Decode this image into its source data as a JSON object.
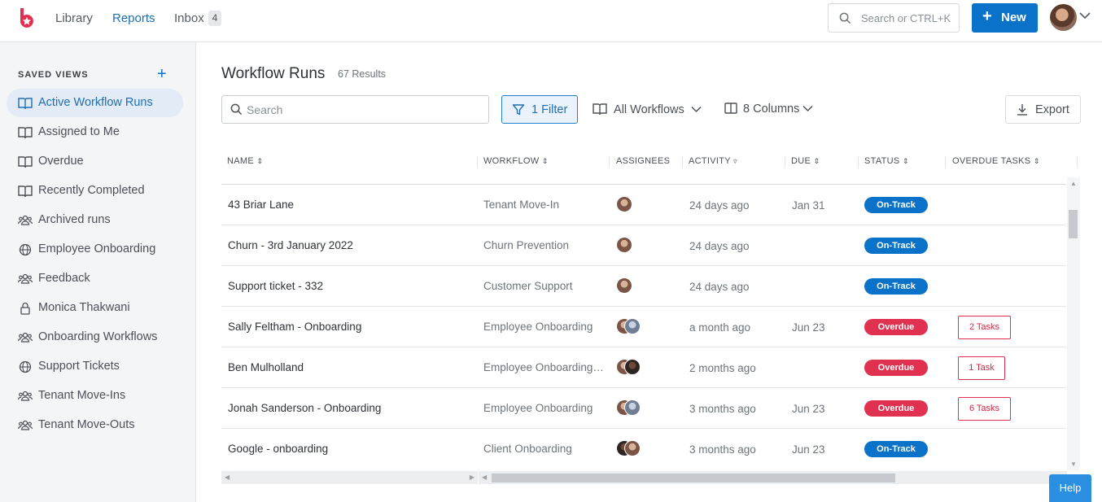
{
  "nav": {
    "library": "Library",
    "reports": "Reports",
    "inbox": "Inbox",
    "inbox_count": "4"
  },
  "header": {
    "search_placeholder": "Search or CTRL+K",
    "new_button": "New"
  },
  "sidebar": {
    "title": "SAVED VIEWS",
    "items": [
      {
        "label": "Active Workflow Runs",
        "icon": "book-icon",
        "active": true
      },
      {
        "label": "Assigned to Me",
        "icon": "book-icon"
      },
      {
        "label": "Overdue",
        "icon": "book-icon"
      },
      {
        "label": "Recently Completed",
        "icon": "book-icon"
      },
      {
        "label": "Archived runs",
        "icon": "users-icon"
      },
      {
        "label": "Employee Onboarding",
        "icon": "globe-icon"
      },
      {
        "label": "Feedback",
        "icon": "users-icon"
      },
      {
        "label": "Monica Thakwani",
        "icon": "lock-icon"
      },
      {
        "label": "Onboarding Workflows",
        "icon": "users-icon"
      },
      {
        "label": "Support Tickets",
        "icon": "globe-icon"
      },
      {
        "label": "Tenant Move-Ins",
        "icon": "users-icon"
      },
      {
        "label": "Tenant Move-Outs",
        "icon": "users-icon"
      }
    ]
  },
  "main": {
    "title": "Workflow Runs",
    "results": "67 Results",
    "search_placeholder": "Search",
    "filter_label": "1 Filter",
    "workflows_label": "All Workflows",
    "columns_label": "8 Columns",
    "export_label": "Export",
    "help_label": "Help"
  },
  "table": {
    "columns": [
      "NAME",
      "WORKFLOW",
      "ASSIGNEES",
      "ACTIVITY",
      "DUE",
      "STATUS",
      "OVERDUE TASKS"
    ],
    "rows": [
      {
        "name": "43 Briar Lane",
        "workflow": "Tenant Move-In",
        "activity": "24 days ago",
        "due": "Jan 31",
        "status": "On-Track",
        "tasks": ""
      },
      {
        "name": "Churn - 3rd January 2022",
        "workflow": "Churn Prevention",
        "activity": "24 days ago",
        "due": "",
        "status": "On-Track",
        "tasks": ""
      },
      {
        "name": "Support ticket - 332",
        "workflow": "Customer Support",
        "activity": "24 days ago",
        "due": "",
        "status": "On-Track",
        "tasks": ""
      },
      {
        "name": "Sally Feltham - Onboarding",
        "workflow": "Employee Onboarding",
        "activity": "a month ago",
        "due": "Jun 23",
        "status": "Overdue",
        "tasks": "2 Tasks"
      },
      {
        "name": "Ben Mulholland",
        "workflow": "Employee Onboarding ...",
        "activity": "2 months ago",
        "due": "",
        "status": "Overdue",
        "tasks": "1 Task"
      },
      {
        "name": "Jonah Sanderson - Onboarding",
        "workflow": "Employee Onboarding",
        "activity": "3 months ago",
        "due": "Jun 23",
        "status": "Overdue",
        "tasks": "6 Tasks"
      },
      {
        "name": "Google - onboarding",
        "workflow": "Client Onboarding",
        "activity": "3 months ago",
        "due": "Jun 23",
        "status": "On-Track",
        "tasks": ""
      }
    ]
  },
  "colors": {
    "primary": "#0b72c9",
    "overdue": "#e03150",
    "active_bg": "#e2ebf6"
  }
}
